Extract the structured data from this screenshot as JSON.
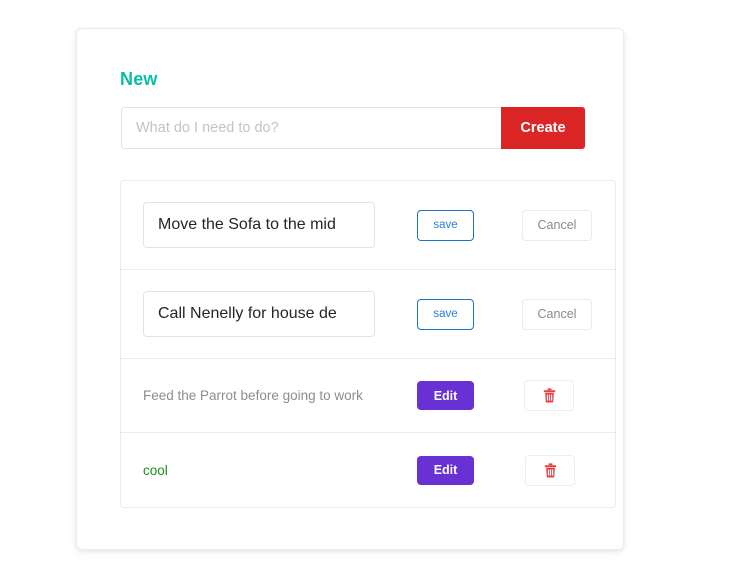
{
  "app": {
    "heading": "New"
  },
  "create_form": {
    "placeholder": "What do I need to do?",
    "value": "",
    "submit_label": "Create",
    "submit_color": "#dc2626"
  },
  "theme": {
    "heading_color": "#07bfa5",
    "save_color": "#2a7fd4",
    "edit_color": "#6930d4",
    "delete_icon_color": "#e84040",
    "completed_text_color": "#1c8c1c",
    "pending_text_color": "#8d8d8d"
  },
  "todos": [
    {
      "mode": "editing",
      "value": "Move the Sofa to the mid",
      "save_label": "save",
      "cancel_label": "Cancel"
    },
    {
      "mode": "editing",
      "value": "Call Nenelly for house de",
      "save_label": "save",
      "cancel_label": "Cancel"
    },
    {
      "mode": "viewing",
      "text": "Feed the Parrot before going to work",
      "state": "pending",
      "edit_label": "Edit",
      "delete_icon": "trash-icon"
    },
    {
      "mode": "viewing",
      "text": "cool",
      "state": "completed",
      "edit_label": "Edit",
      "delete_icon": "trash-icon"
    }
  ]
}
